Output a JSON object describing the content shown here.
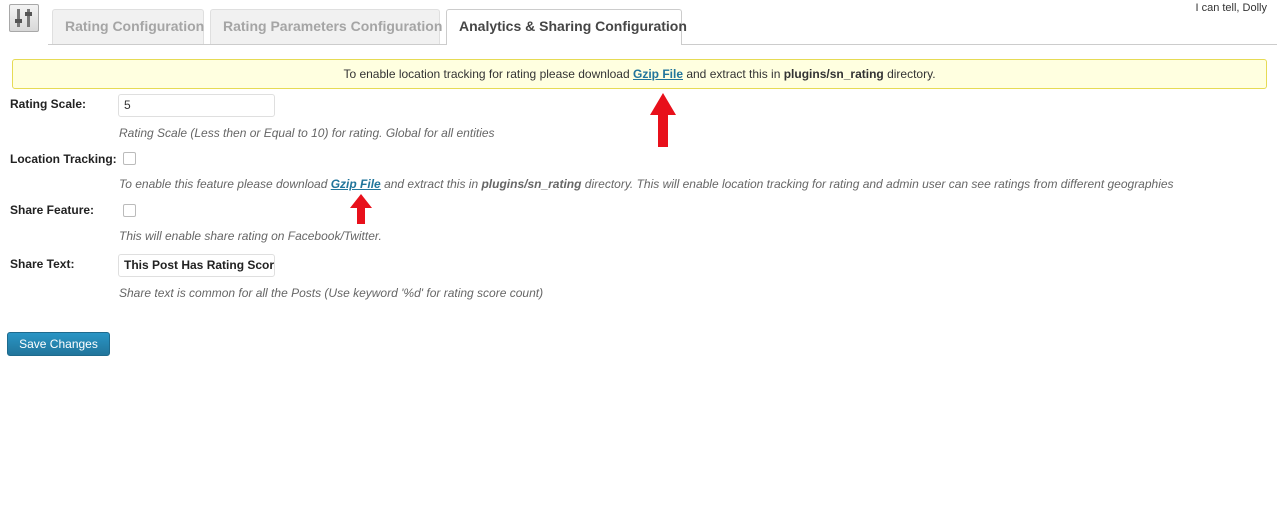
{
  "header": {
    "plugin_icon": "sliders-icon",
    "tabs": [
      {
        "label": "Rating Configuration",
        "active": false
      },
      {
        "label": "Rating Parameters Configuration",
        "active": false
      },
      {
        "label": "Analytics & Sharing Configuration",
        "active": true
      }
    ],
    "howdy": "I can tell, Dolly"
  },
  "notice": {
    "prefix": "To enable location tracking for rating please download ",
    "link": "Gzip File",
    "middle": " and extract this in ",
    "path": "plugins/sn_rating",
    "suffix": " directory."
  },
  "form": {
    "rating_scale": {
      "label": "Rating Scale:",
      "value": "5",
      "description": "Rating Scale (Less then or Equal to 10) for rating. Global for all entities"
    },
    "location_tracking": {
      "label": "Location Tracking:",
      "checked": false,
      "desc_prefix": "To enable this feature please download ",
      "desc_link": "Gzip File",
      "desc_middle": " and extract this in ",
      "desc_path": "plugins/sn_rating",
      "desc_suffix": " directory. This will enable location tracking for rating and admin user can see ratings from different geographies"
    },
    "share_feature": {
      "label": "Share Feature:",
      "checked": false,
      "description": "This will enable share rating on Facebook/Twitter."
    },
    "share_text": {
      "label": "Share Text:",
      "value": "This Post Has Rating Scor",
      "description": "Share text is common for all the Posts (Use keyword '%d' for rating score count)"
    }
  },
  "save_label": "Save Changes",
  "colors": {
    "accent": "#21759b",
    "notice_bg": "#ffffe0",
    "notice_border": "#e6db55",
    "arrow": "#e8101b"
  }
}
